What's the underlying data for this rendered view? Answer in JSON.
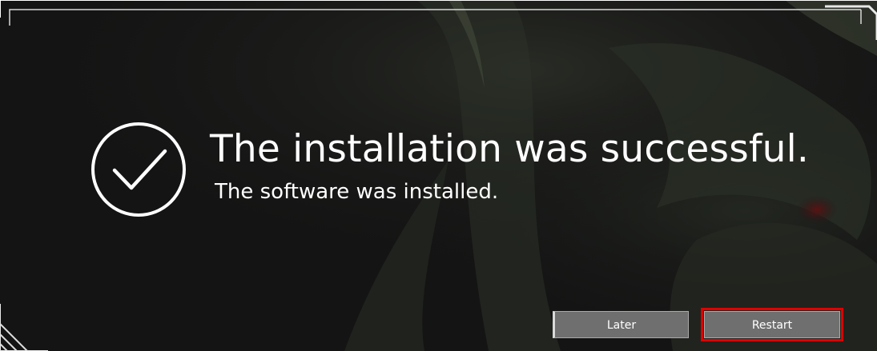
{
  "dialog": {
    "title": "The installation was successful.",
    "subtitle": "The software was installed.",
    "icon": "check-circle-icon"
  },
  "buttons": {
    "later_label": "Later",
    "restart_label": "Restart"
  },
  "colors": {
    "background": "#141414",
    "text": "#ffffff",
    "button": "#6f6f6f",
    "highlight": "#e00000"
  }
}
